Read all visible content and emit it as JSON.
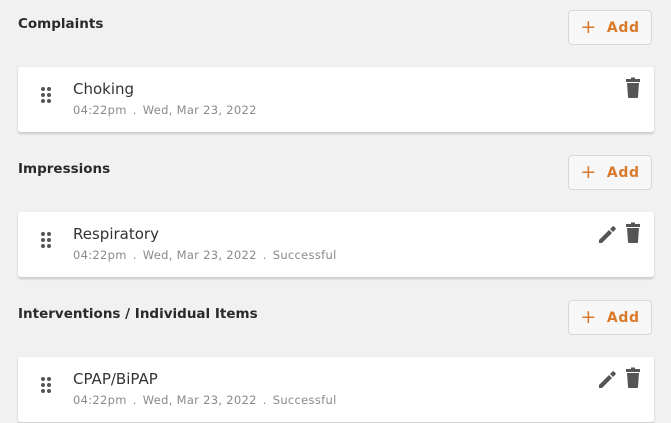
{
  "sections": [
    {
      "title": "Complaints",
      "add_label": "Add",
      "item": {
        "name": "Choking",
        "time": "04:22pm",
        "date": "Wed, Mar 23, 2022",
        "status": ""
      }
    },
    {
      "title": "Impressions",
      "add_label": "Add",
      "item": {
        "name": "Respiratory",
        "time": "04:22pm",
        "date": "Wed, Mar 23, 2022",
        "status": "Successful"
      }
    },
    {
      "title": "Interventions / Individual Items",
      "add_label": "Add",
      "item": {
        "name": "CPAP/BiPAP",
        "time": "04:22pm",
        "date": "Wed, Mar 23, 2022",
        "status": "Successful"
      }
    }
  ],
  "meta_separator": ".",
  "icons": {
    "add": "plus-icon",
    "drag": "drag-handle-icon",
    "edit": "pencil-icon",
    "delete": "trash-icon"
  },
  "colors": {
    "accent": "#d97a2b",
    "icon": "#555555",
    "background": "#f1f1f1"
  }
}
